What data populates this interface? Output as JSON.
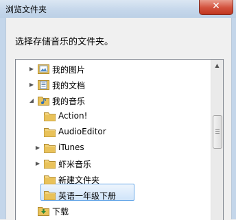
{
  "dialog": {
    "title": "浏览文件夹",
    "close_glyph": "✕",
    "prompt": "选择存储音乐的文件夹。"
  },
  "tree": {
    "items": [
      {
        "label": "我的图片",
        "level": 0,
        "expander": "▶",
        "icon": "pictures-icon"
      },
      {
        "label": "我的文档",
        "level": 0,
        "expander": "▶",
        "icon": "documents-icon"
      },
      {
        "label": "我的音乐",
        "level": 0,
        "expander": "◢",
        "icon": "music-folder-icon"
      },
      {
        "label": "Action!",
        "level": 1,
        "expander": "",
        "icon": "folder-icon"
      },
      {
        "label": "AudioEditor",
        "level": 1,
        "expander": "",
        "icon": "folder-icon"
      },
      {
        "label": "iTunes",
        "level": 1,
        "expander": "▶",
        "icon": "folder-icon"
      },
      {
        "label": "虾米音乐",
        "level": 1,
        "expander": "▶",
        "icon": "folder-icon"
      },
      {
        "label": "新建文件夹",
        "level": 1,
        "expander": "",
        "icon": "folder-icon"
      },
      {
        "label": "英语一年级下册",
        "level": 1,
        "expander": "",
        "icon": "folder-icon",
        "selected": true
      },
      {
        "label": "下载",
        "level": 0,
        "expander": "",
        "icon": "download-icon"
      }
    ]
  },
  "scrollbar": {
    "up_glyph": "▲"
  }
}
